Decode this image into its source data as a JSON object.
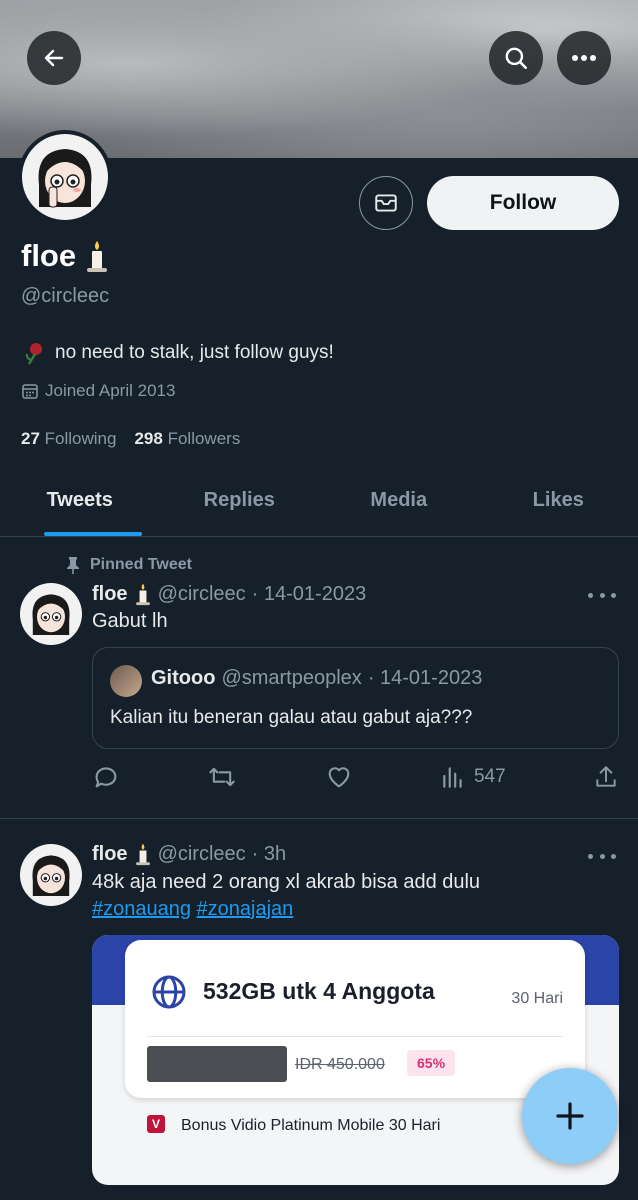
{
  "header": {
    "back_icon": "back-arrow-icon",
    "search_icon": "search-icon",
    "more_icon": "more-icon"
  },
  "profile": {
    "name": "floe",
    "name_emoji": "candle",
    "handle": "@circleec",
    "bio": "no need to stalk, just follow guys!",
    "joined": "Joined April 2013",
    "following_count": "27",
    "following_label": "Following",
    "followers_count": "298",
    "followers_label": "Followers",
    "follow_label": "Follow"
  },
  "tabs": [
    {
      "label": "Tweets"
    },
    {
      "label": "Replies"
    },
    {
      "label": "Media"
    },
    {
      "label": "Likes"
    }
  ],
  "pinned_tweet": {
    "pinned_label": "Pinned Tweet",
    "name": "floe",
    "handle": "@circleec",
    "date": "· 14-01-2023",
    "text": "Gabut lh",
    "quote": {
      "name": "Gitooo",
      "handle": "@smartpeoplex",
      "date": "· 14-01-2023",
      "text": "Kalian itu beneran galau atau gabut aja???"
    },
    "views": "547"
  },
  "second_tweet": {
    "name": "floe",
    "handle": "@circleec",
    "time": "· 3h",
    "text": "48k aja need 2 orang xl akrab bisa add dulu",
    "hashtag_1": "#zonauang",
    "hashtag_2": "#zonajajan",
    "media": {
      "title": "532GB utk 4 Anggota",
      "duration": "30 Hari",
      "old_price": "IDR 450.000",
      "discount": "65%",
      "bonus": "Bonus Vidio Platinum Mobile 30 Hari"
    }
  },
  "colors": {
    "background": "#15202b",
    "accent": "#1d9bf0",
    "fab": "#8ecdf8"
  }
}
